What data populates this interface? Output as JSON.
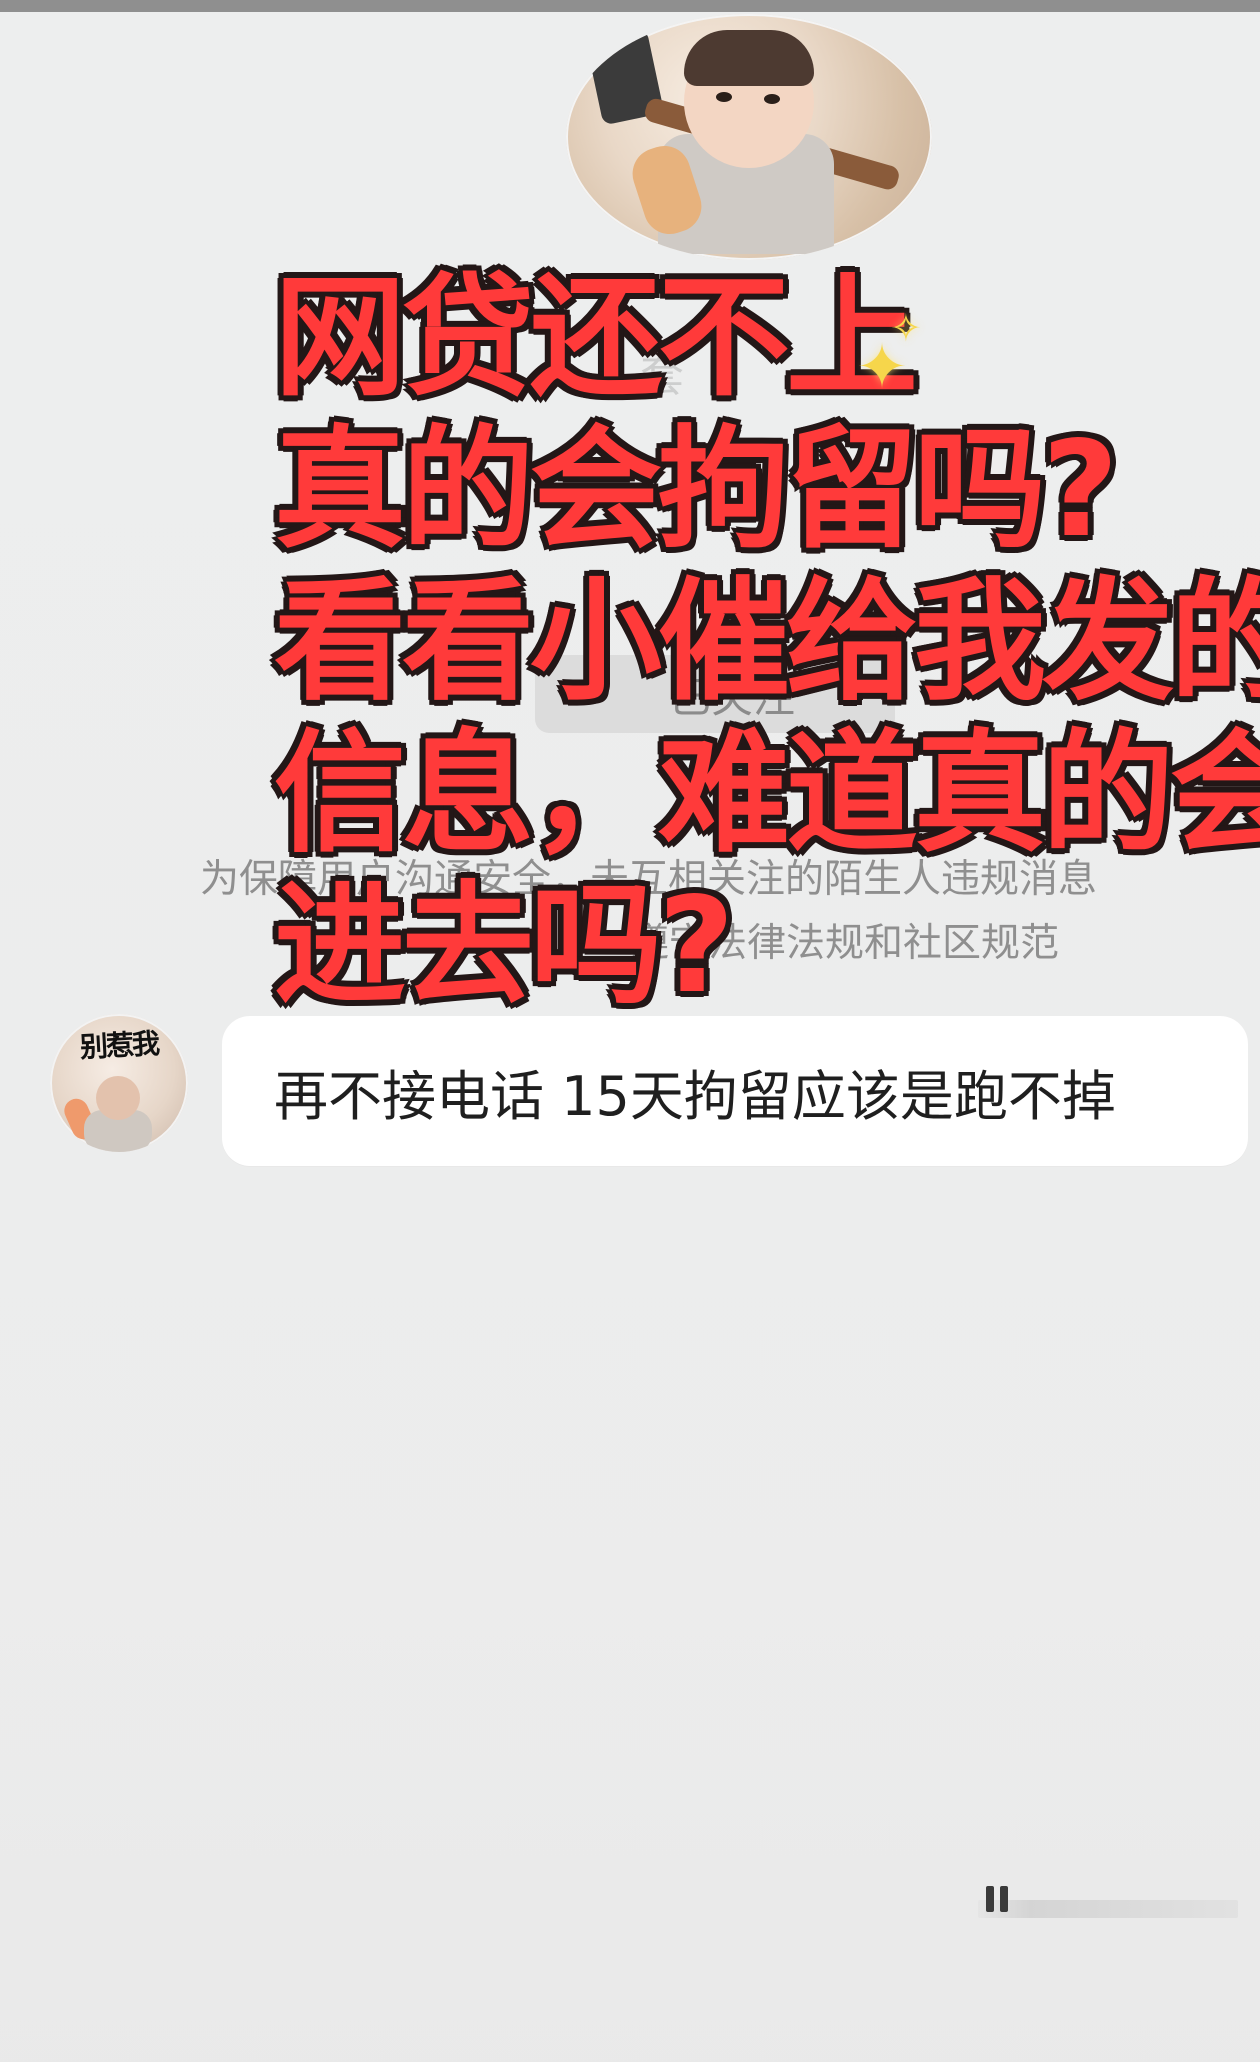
{
  "screen": {
    "header_avatar_alt": "baby-with-hammer-avatar"
  },
  "overlay": {
    "lines": [
      "网贷还不上",
      "真的会拘留吗?",
      "看看小催给我发的",
      "信息，难道真的会",
      "进去吗?"
    ]
  },
  "background_ui": {
    "partial_title": "套",
    "follow_button_label": "已关注",
    "notice_line_1": "为保障用户沟通安全，未互相关注的陌生人违规消息",
    "notice_line_2": "遵守法律法规和社区规范"
  },
  "chat": {
    "avatar_caption": "别惹我",
    "message": "再不接电话 15天拘留应该是跑不掉"
  },
  "icons": {
    "sparkle": "sparkle-icon",
    "avatar": "avatar-icon"
  },
  "colors": {
    "background": "#ececec",
    "overlay_text": "#ff3a3a",
    "overlay_stroke": "#231717",
    "bubble": "#ffffff",
    "notice_text": "#8f8f8f"
  }
}
